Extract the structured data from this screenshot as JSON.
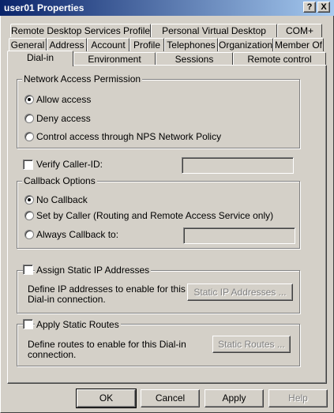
{
  "window": {
    "title": "user01 Properties",
    "help_button": "?",
    "close_button": "X"
  },
  "tabs_row1": [
    "Remote Desktop Services Profile",
    "Personal Virtual Desktop",
    "COM+"
  ],
  "tabs_row2": [
    "General",
    "Address",
    "Account",
    "Profile",
    "Telephones",
    "Organization",
    "Member Of"
  ],
  "tabs_row3": [
    "Dial-in",
    "Environment",
    "Sessions",
    "Remote control"
  ],
  "active_tab": "Dial-in",
  "network_access": {
    "title": "Network Access Permission",
    "options": [
      "Allow access",
      "Deny access",
      "Control access through NPS Network Policy"
    ],
    "selected": "Allow access"
  },
  "verify_caller": {
    "label": "Verify Caller-ID:",
    "checked": false,
    "value": ""
  },
  "callback": {
    "title": "Callback Options",
    "options": [
      "No Callback",
      "Set by Caller (Routing and Remote Access Service only)",
      "Always Callback to:"
    ],
    "selected": "No Callback",
    "always_value": ""
  },
  "static_ip": {
    "label": "Assign Static IP Addresses",
    "checked": false,
    "description": [
      "Define IP addresses to enable for this",
      "Dial-in connection."
    ],
    "button": "Static IP Addresses ..."
  },
  "static_routes": {
    "label": "Apply Static Routes",
    "checked": false,
    "description": [
      "Define routes to enable for this Dial-in",
      "connection."
    ],
    "button": "Static Routes ..."
  },
  "buttons": {
    "ok": "OK",
    "cancel": "Cancel",
    "apply": "Apply",
    "help": "Help"
  }
}
